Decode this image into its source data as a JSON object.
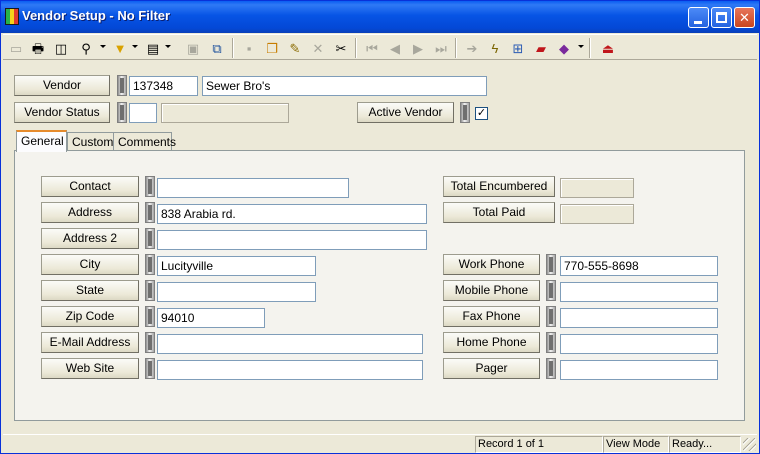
{
  "window": {
    "title": "Vendor Setup - No Filter",
    "accent": "#0054e3"
  },
  "toolbar": {
    "icons": [
      "new-record-icon",
      "print-icon",
      "print-preview-icon",
      "search-icon",
      "filter-icon",
      "report-icon",
      "page-icon",
      "export-icon",
      "save-icon",
      "copy-records-icon",
      "edit-icon",
      "delete-icon",
      "cut-icon",
      "first-record-icon",
      "previous-record-icon",
      "next-record-icon",
      "last-record-icon",
      "go-to-icon",
      "lightning-icon",
      "diagram-icon",
      "flag-icon",
      "book-icon",
      "exit-icon"
    ]
  },
  "header": {
    "vendor_label": "Vendor",
    "vendor_id": "137348",
    "vendor_name": "Sewer Bro's",
    "status_label": "Vendor Status",
    "status_code": "",
    "status_desc": "",
    "active_label": "Active Vendor",
    "active_checked": true,
    "check_mark": "✓"
  },
  "tabs": [
    "General",
    "Custom",
    "Comments"
  ],
  "general": {
    "contact_label": "Contact",
    "contact": "",
    "address_label": "Address",
    "address": "838 Arabia rd.",
    "address2_label": "Address 2",
    "address2": "",
    "city_label": "City",
    "city": "Lucityville",
    "state_label": "State",
    "state": "",
    "zip_label": "Zip Code",
    "zip": "94010",
    "email_label": "E-Mail Address",
    "email": "",
    "website_label": "Web Site",
    "website": "",
    "total_encumbered_label": "Total Encumbered",
    "total_encumbered": "",
    "total_paid_label": "Total Paid",
    "total_paid": "",
    "work_phone_label": "Work Phone",
    "work_phone": "770-555-8698",
    "mobile_phone_label": "Mobile Phone",
    "mobile_phone": "",
    "fax_phone_label": "Fax Phone",
    "fax_phone": "",
    "home_phone_label": "Home Phone",
    "home_phone": "",
    "pager_label": "Pager",
    "pager": ""
  },
  "status": {
    "record": "Record 1 of 1",
    "mode": "View Mode",
    "state": "Ready..."
  }
}
